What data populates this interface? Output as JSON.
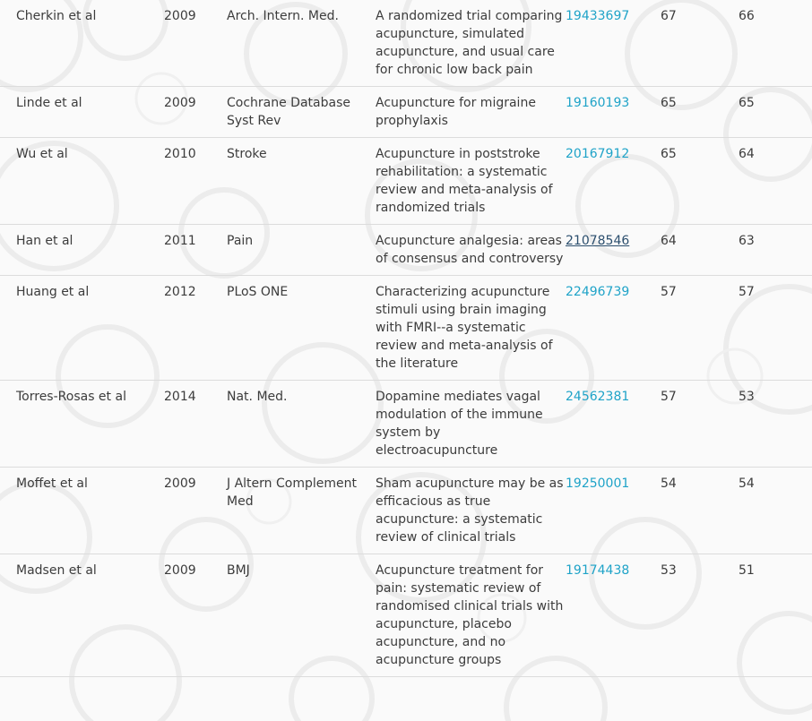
{
  "references": [
    {
      "author": "Cherkin et al",
      "year": "2009",
      "journal": "Arch. Intern. Med.",
      "title": "A randomized trial comparing acupuncture, simulated acupuncture, and usual care for chronic low back pain",
      "pmid": "19433697",
      "n1": "67",
      "n2": "66",
      "underlined": false
    },
    {
      "author": "Linde et al",
      "year": "2009",
      "journal": "Cochrane Database Syst Rev",
      "title": "Acupuncture for migraine prophylaxis",
      "pmid": "19160193",
      "n1": "65",
      "n2": "65",
      "underlined": false
    },
    {
      "author": "Wu et al",
      "year": "2010",
      "journal": "Stroke",
      "title": "Acupuncture in poststroke rehabilitation: a systematic review and meta-analysis of randomized trials",
      "pmid": "20167912",
      "n1": "65",
      "n2": "64",
      "underlined": false
    },
    {
      "author": "Han et al",
      "year": "2011",
      "journal": "Pain",
      "title": "Acupuncture analgesia: areas of consensus and controversy",
      "pmid": "21078546",
      "n1": "64",
      "n2": "63",
      "underlined": true
    },
    {
      "author": "Huang et al",
      "year": "2012",
      "journal": "PLoS ONE",
      "title": "Characterizing acupuncture stimuli using brain imaging with FMRI--a systematic review and meta-analysis of the literature",
      "pmid": "22496739",
      "n1": "57",
      "n2": "57",
      "underlined": false
    },
    {
      "author": "Torres-Rosas et al",
      "year": "2014",
      "journal": "Nat. Med.",
      "title": "Dopamine mediates vagal modulation of the immune system by electroacupuncture",
      "pmid": "24562381",
      "n1": "57",
      "n2": "53",
      "underlined": false
    },
    {
      "author": "Moffet et al",
      "year": "2009",
      "journal": "J Altern Complement Med",
      "title": "Sham acupuncture may be as efficacious as true acupuncture: a systematic review of clinical trials",
      "pmid": "19250001",
      "n1": "54",
      "n2": "54",
      "underlined": false
    },
    {
      "author": "Madsen et al",
      "year": "2009",
      "journal": "BMJ",
      "title": "Acupuncture treatment for pain: systematic review of randomised clinical trials with acupuncture, placebo acupuncture, and no acupuncture groups",
      "pmid": "19174438",
      "n1": "53",
      "n2": "51",
      "underlined": false
    }
  ],
  "colors": {
    "link": "#1fa3c8",
    "link_visited": "#2c4f6e",
    "text": "#3c3c3c",
    "row_border": "#dcdcdc",
    "background": "#fafafa"
  }
}
